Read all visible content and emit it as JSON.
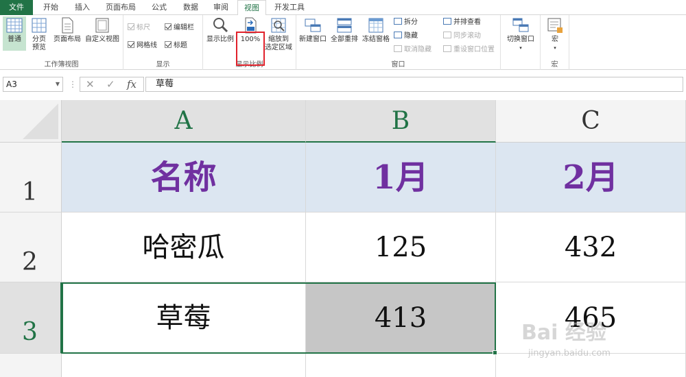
{
  "tabs": [
    {
      "label": "文件",
      "kind": "file"
    },
    {
      "label": "开始"
    },
    {
      "label": "插入"
    },
    {
      "label": "页面布局"
    },
    {
      "label": "公式"
    },
    {
      "label": "数据"
    },
    {
      "label": "审阅"
    },
    {
      "label": "视图",
      "kind": "active"
    },
    {
      "label": "开发工具"
    }
  ],
  "ribbon": {
    "workbook_views": {
      "label": "工作簿视图",
      "normal": "普通",
      "page_break_line1": "分页",
      "page_break_line2": "预览",
      "page_layout": "页面布局",
      "custom_views": "自定义视图"
    },
    "show": {
      "label": "显示",
      "ruler": "标尺",
      "formula_bar": "编辑栏",
      "gridlines": "网格线",
      "headings": "标题"
    },
    "zoom": {
      "label": "显示比例",
      "zoom": "显示比例",
      "hundred": "100%",
      "zoom_sel_line1": "缩放到",
      "zoom_sel_line2": "选定区域"
    },
    "window": {
      "label": "窗口",
      "new_window": "新建窗口",
      "arrange_all": "全部重排",
      "freeze_panes": "冻结窗格",
      "split": "拆分",
      "hide": "隐藏",
      "unhide": "取消隐藏",
      "side_by_side": "并排查看",
      "sync_scroll": "同步滚动",
      "reset_position": "重设窗口位置",
      "switch_windows": "切换窗口"
    },
    "macros": {
      "label": "宏",
      "macros": "宏"
    }
  },
  "formula_bar": {
    "name_box": "A3",
    "fx": "fx",
    "content": "草莓"
  },
  "sheet": {
    "columns": [
      "A",
      "B",
      "C"
    ],
    "rows": [
      "1",
      "2",
      "3"
    ],
    "cells": {
      "r1": [
        "名称",
        "1月",
        "2月"
      ],
      "r2": [
        "哈密瓜",
        "125",
        "432"
      ],
      "r3": [
        "草莓",
        "413",
        "465"
      ]
    }
  },
  "watermark": {
    "brand": "Bai 经验",
    "url": "jingyan.baidu.com"
  },
  "colors": {
    "accent": "#217346",
    "header_fill": "#dce6f1",
    "header_text": "#7030a0",
    "highlight": "#e0202a"
  }
}
